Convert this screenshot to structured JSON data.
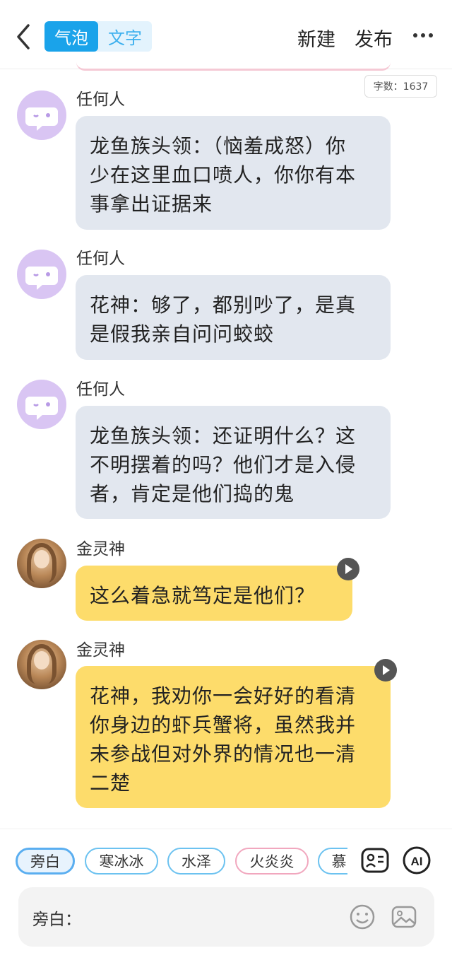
{
  "header": {
    "mode_tabs": [
      "气泡",
      "文字"
    ],
    "new_label": "新建",
    "publish_label": "发布"
  },
  "word_count": "字数：1637",
  "messages": [
    {
      "sender": "任何人",
      "text": [
        "龙鱼族头领：（恼羞成怒）你",
        "少在这里血口喷人，你你有本",
        "事拿出证据来"
      ],
      "style": "gray"
    },
    {
      "sender": "任何人",
      "text": [
        "花神：够了，都别吵了，是真",
        "是假我亲自问问蛟蛟"
      ],
      "style": "gray"
    },
    {
      "sender": "任何人",
      "text": [
        "龙鱼族头领：还证明什么？这",
        "不明摆着的吗？他们才是入侵",
        "者，肯定是他们捣的鬼"
      ],
      "style": "gray"
    },
    {
      "sender": "金灵神",
      "text": [
        "这么着急就笃定是他们？"
      ],
      "style": "yellow"
    },
    {
      "sender": "金灵神",
      "text": [
        "花神，我劝你一会好好的看清",
        "你身边的虾兵蟹将，虽然我并",
        "未参战但对外界的情况也一清",
        "二楚"
      ],
      "style": "yellow"
    }
  ],
  "role_chips": [
    "旁白",
    "寒冰冰",
    "水泽",
    "火炎炎",
    "慕"
  ],
  "input": {
    "label": "旁白："
  },
  "colors": {
    "accent": "#1aa3ea",
    "gray_bubble": "#e2e7ef",
    "yellow_bubble": "#fddc6b",
    "avatar_generic": "#d9c5f3"
  },
  "icons": [
    "back-icon",
    "more-icon",
    "chat-bubble-icon",
    "play-icon",
    "role-card-icon",
    "ai-icon",
    "emoji-icon",
    "image-icon"
  ]
}
